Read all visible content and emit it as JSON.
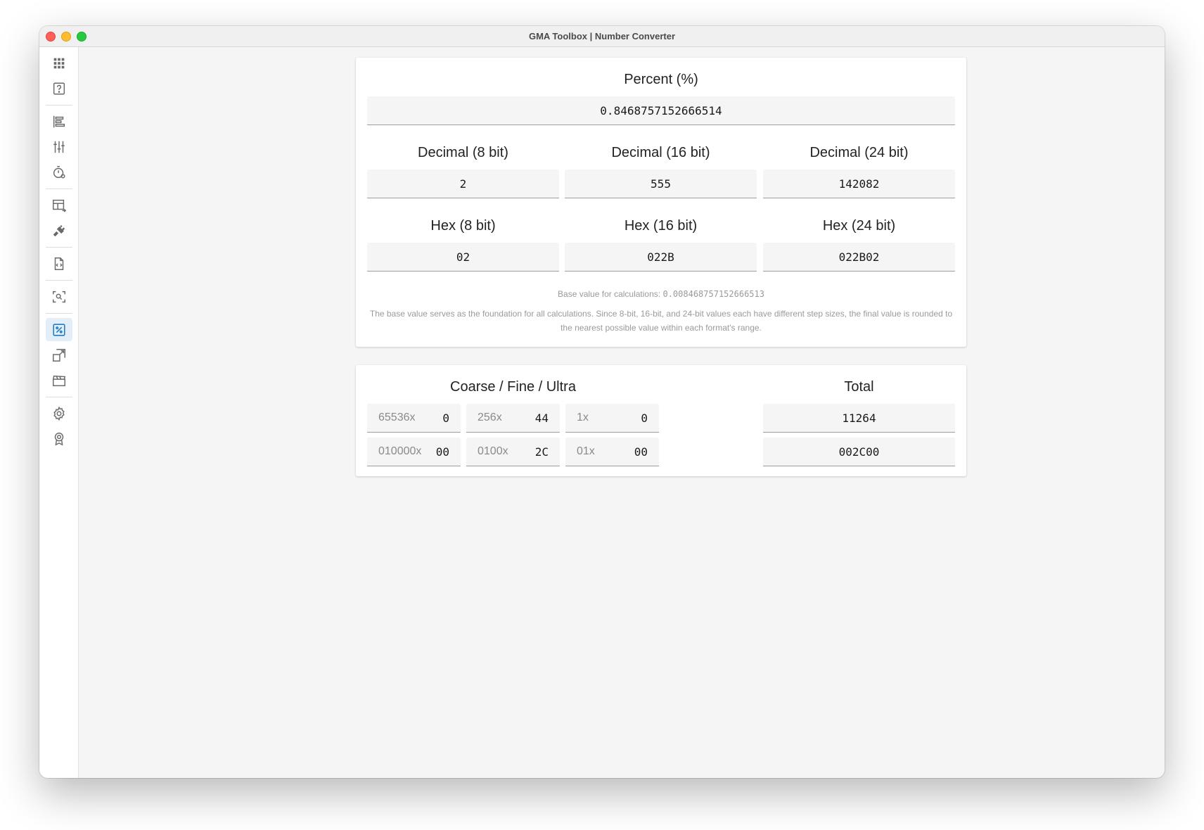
{
  "window": {
    "title": "GMA Toolbox | Number Converter"
  },
  "sidebar": {
    "items": [
      {
        "icon": "grid-icon"
      },
      {
        "icon": "help-icon"
      },
      {
        "icon": "align-left-icon"
      },
      {
        "icon": "sliders-icon"
      },
      {
        "icon": "timer-icon"
      },
      {
        "icon": "table-icon"
      },
      {
        "icon": "plug-icon"
      },
      {
        "icon": "file-code-icon"
      },
      {
        "icon": "scan-search-icon"
      },
      {
        "icon": "percent-icon",
        "active": true
      },
      {
        "icon": "image-resize-icon"
      },
      {
        "icon": "clapperboard-icon"
      },
      {
        "icon": "gear-icon"
      },
      {
        "icon": "award-icon"
      }
    ]
  },
  "converter": {
    "percent_label": "Percent (%)",
    "percent_value": "0.8468757152666514",
    "dec8_label": "Decimal (8 bit)",
    "dec16_label": "Decimal (16 bit)",
    "dec24_label": "Decimal (24 bit)",
    "dec8_value": "2",
    "dec16_value": "555",
    "dec24_value": "142082",
    "hex8_label": "Hex (8 bit)",
    "hex16_label": "Hex (16 bit)",
    "hex24_label": "Hex (24 bit)",
    "hex8_value": "02",
    "hex16_value": "022B",
    "hex24_value": "022B02",
    "base_label": "Base value for calculations:",
    "base_value": "0.008468757152666513",
    "description": "The base value serves as the foundation for all calculations. Since 8-bit, 16-bit, and 24-bit values each have different step sizes, the final value is rounded to the nearest possible value within each format's range."
  },
  "cfu": {
    "title": "Coarse / Fine / Ultra",
    "total_label": "Total",
    "dec_row": [
      {
        "prefix": "65536x",
        "value": "0"
      },
      {
        "prefix": "256x",
        "value": "44"
      },
      {
        "prefix": "1x",
        "value": "0"
      }
    ],
    "hex_row": [
      {
        "prefix": "010000x",
        "value": "00"
      },
      {
        "prefix": "0100x",
        "value": "2C"
      },
      {
        "prefix": "01x",
        "value": "00"
      }
    ],
    "total_dec": "11264",
    "total_hex": "002C00"
  },
  "colors": {
    "accent": "#1f7fc4",
    "window_bg": "#f5f5f5"
  }
}
